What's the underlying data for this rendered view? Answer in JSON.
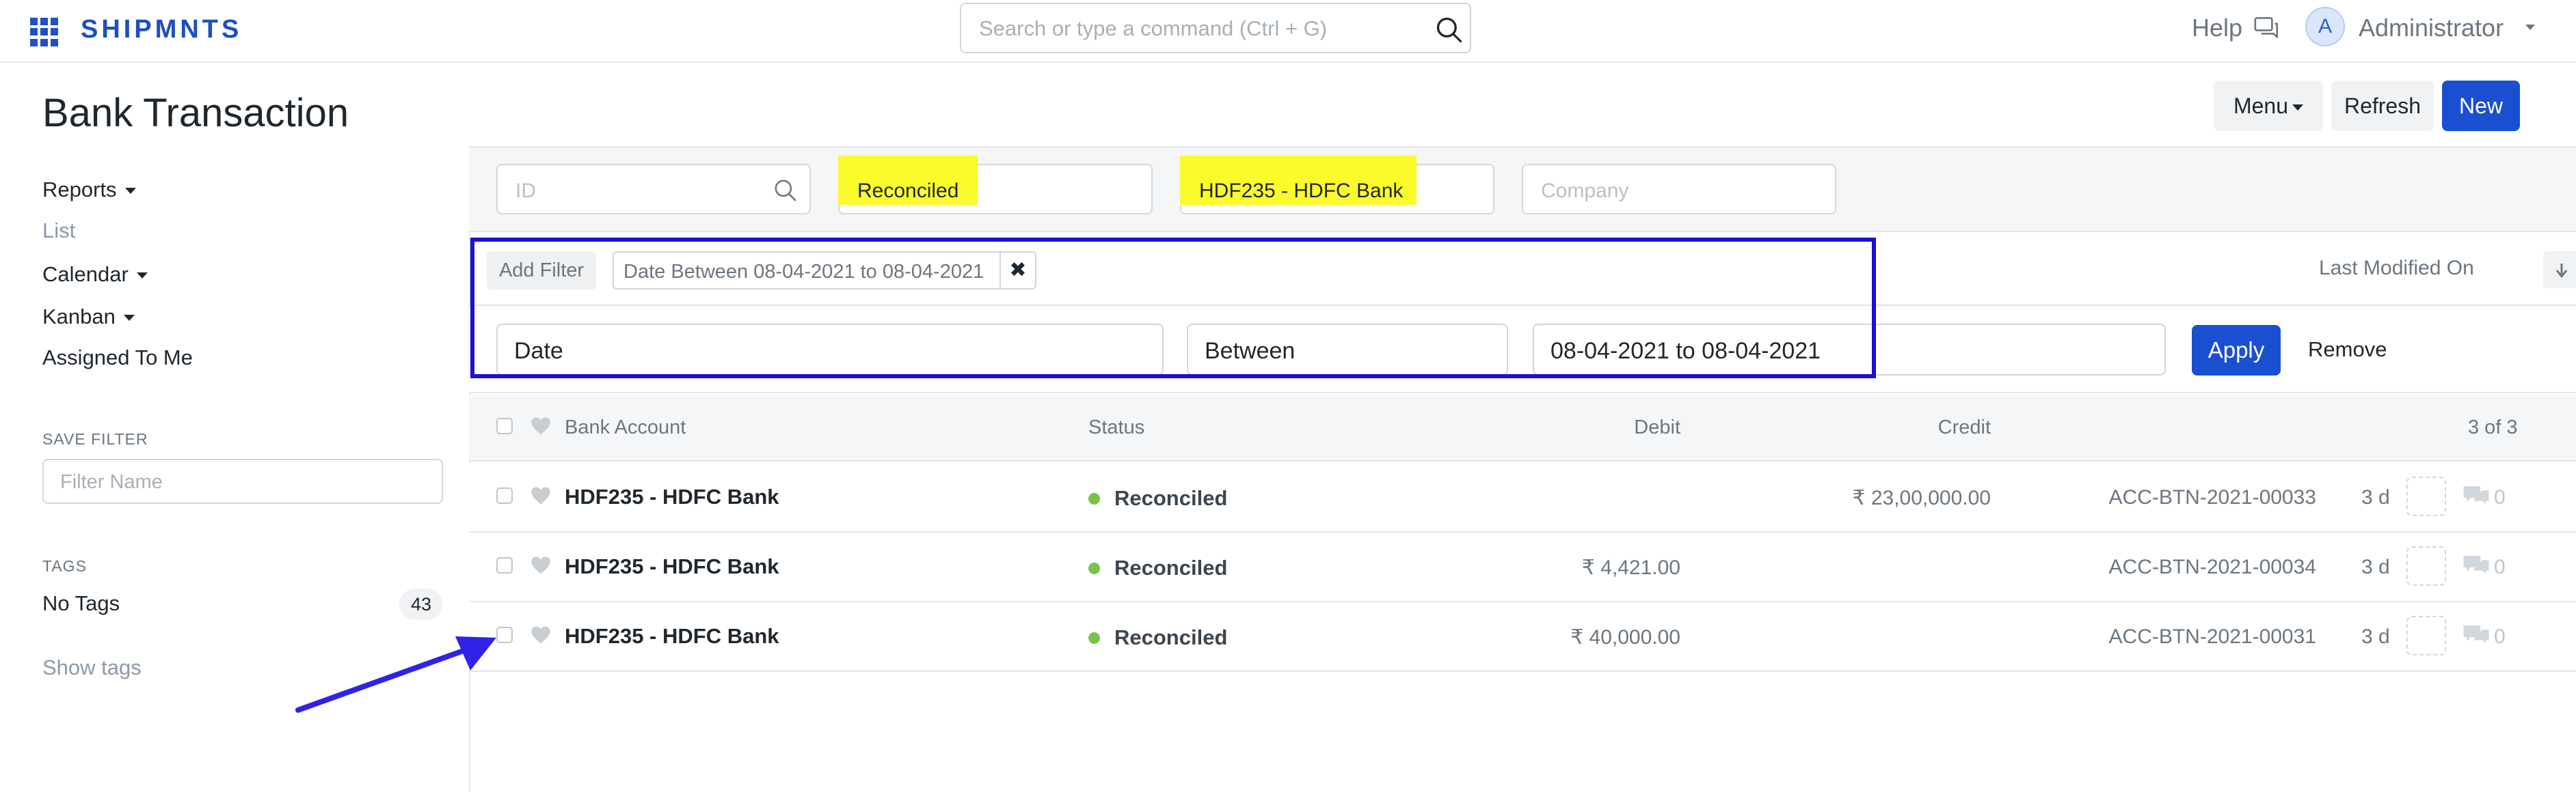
{
  "navbar": {
    "brand": "SHIPMNTS",
    "search_placeholder": "Search or type a command (Ctrl + G)",
    "help_label": "Help",
    "avatar_letter": "A",
    "user_name": "Administrator"
  },
  "page": {
    "title": "Bank Transaction",
    "menu_label": "Menu",
    "refresh_label": "Refresh",
    "new_label": "New"
  },
  "sidebar": {
    "reports": "Reports",
    "list": "List",
    "calendar": "Calendar",
    "kanban": "Kanban",
    "assigned_to_me": "Assigned To Me",
    "save_filter_heading": "SAVE FILTER",
    "filter_name_placeholder": "Filter Name",
    "tags_heading": "TAGS",
    "no_tags": "No Tags",
    "no_tags_count": "43",
    "show_tags": "Show tags"
  },
  "standard_filters": {
    "id_placeholder": "ID",
    "status_value": "Reconciled",
    "bank_account_value": "HDF235 - HDFC Bank",
    "company_placeholder": "Company"
  },
  "filter_bar": {
    "add_filter_label": "Add Filter",
    "active_filter": "Date Between 08-04-2021 to 08-04-2021",
    "sort_label": "Last Modified On"
  },
  "condition": {
    "field": "Date",
    "operator": "Between",
    "value": "08-04-2021 to 08-04-2021",
    "apply_label": "Apply",
    "remove_label": "Remove"
  },
  "list": {
    "headers": {
      "bank_account": "Bank Account",
      "status": "Status",
      "debit": "Debit",
      "credit": "Credit",
      "count": "3 of 3"
    },
    "rows": [
      {
        "bank_account": "HDF235 - HDFC Bank",
        "status": "Reconciled",
        "debit": "",
        "credit": "₹ 23,00,000.00",
        "name": "ACC-BTN-2021-00033",
        "age": "3 d",
        "comments": "0"
      },
      {
        "bank_account": "HDF235 - HDFC Bank",
        "status": "Reconciled",
        "debit": "₹ 4,421.00",
        "credit": "",
        "name": "ACC-BTN-2021-00034",
        "age": "3 d",
        "comments": "0"
      },
      {
        "bank_account": "HDF235 - HDFC Bank",
        "status": "Reconciled",
        "debit": "₹ 40,000.00",
        "credit": "",
        "name": "ACC-BTN-2021-00031",
        "age": "3 d",
        "comments": "0"
      }
    ]
  },
  "colors": {
    "primary": "#1a4fd1",
    "highlight": "#fbfb2b",
    "annotation": "#1b0fd6",
    "status_reconciled": "#78c24a"
  }
}
